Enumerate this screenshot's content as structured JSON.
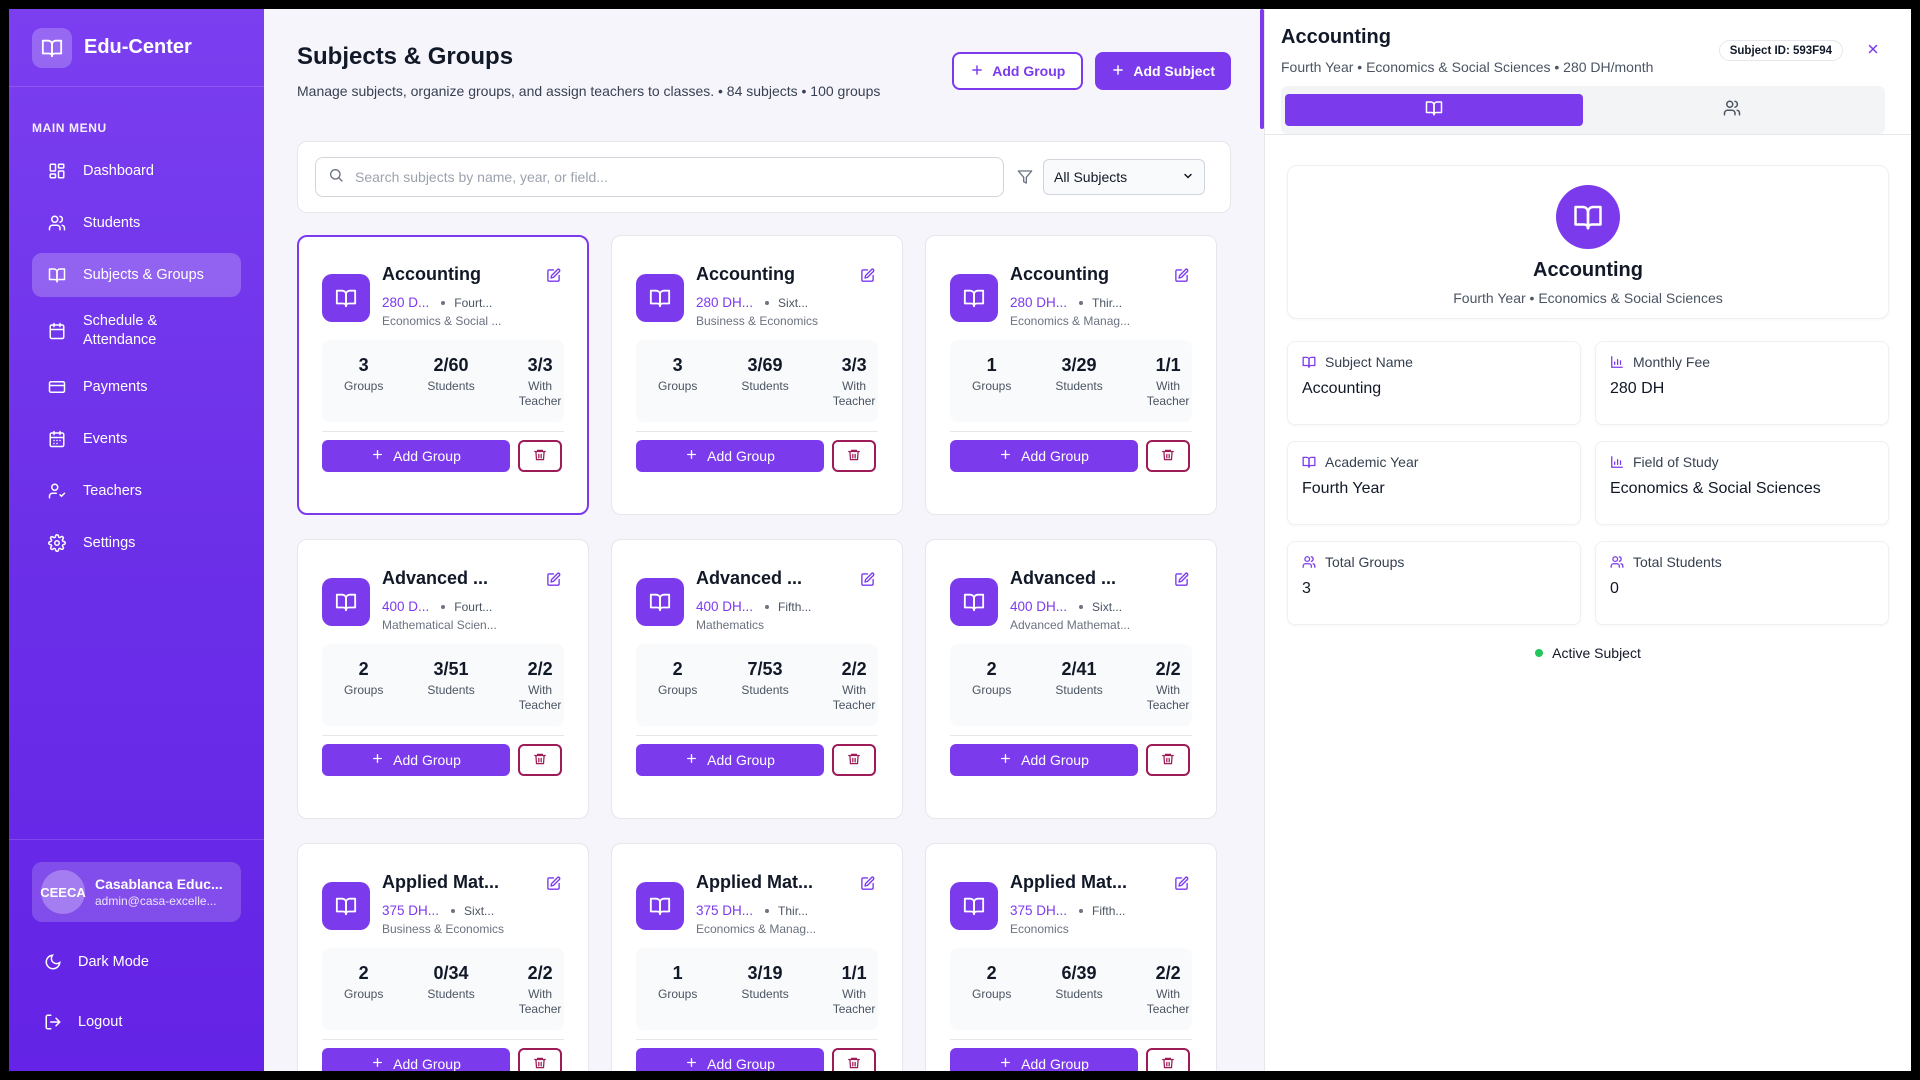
{
  "brand": {
    "name": "Edu-Center"
  },
  "sidebar": {
    "menu_title": "MAIN MENU",
    "items": [
      {
        "label": "Dashboard",
        "icon": "dashboard-icon"
      },
      {
        "label": "Students",
        "icon": "users-icon"
      },
      {
        "label": "Subjects & Groups",
        "icon": "book-icon",
        "active": true
      },
      {
        "label": "Schedule & Attendance",
        "icon": "calendar-icon"
      },
      {
        "label": "Payments",
        "icon": "credit-card-icon"
      },
      {
        "label": "Events",
        "icon": "calendar-days-icon"
      },
      {
        "label": "Teachers",
        "icon": "teacher-icon"
      },
      {
        "label": "Settings",
        "icon": "gear-icon"
      }
    ],
    "user": {
      "initials": "CEECA",
      "name": "Casablanca Educ...",
      "email": "admin@casa-excelle..."
    },
    "dark_mode_label": "Dark Mode",
    "logout_label": "Logout"
  },
  "page": {
    "title": "Subjects & Groups",
    "subtitle": "Manage subjects, organize groups, and assign teachers to classes. • 84 subjects • 100 groups",
    "add_group_label": "Add Group",
    "add_subject_label": "Add Subject",
    "search_placeholder": "Search subjects by name, year, or field...",
    "filter_value": "All Subjects"
  },
  "labels": {
    "groups": "Groups",
    "students": "Students",
    "with_teacher": "With Teacher",
    "add_group": "Add Group"
  },
  "cards": [
    {
      "title": "Accounting",
      "fee": "280 D...",
      "year": "Fourt...",
      "field": "Economics & Social ...",
      "groups": "3",
      "students": "2/60",
      "with_teacher": "3/3",
      "selected": true
    },
    {
      "title": "Accounting",
      "fee": "280 DH...",
      "year": "Sixt...",
      "field": "Business & Economics",
      "groups": "3",
      "students": "3/69",
      "with_teacher": "3/3"
    },
    {
      "title": "Accounting",
      "fee": "280 DH...",
      "year": "Thir...",
      "field": "Economics & Manag...",
      "groups": "1",
      "students": "3/29",
      "with_teacher": "1/1"
    },
    {
      "title": "Advanced ...",
      "fee": "400 D...",
      "year": "Fourt...",
      "field": "Mathematical Scien...",
      "groups": "2",
      "students": "3/51",
      "with_teacher": "2/2"
    },
    {
      "title": "Advanced ...",
      "fee": "400 DH...",
      "year": "Fifth...",
      "field": "Mathematics",
      "groups": "2",
      "students": "7/53",
      "with_teacher": "2/2"
    },
    {
      "title": "Advanced ...",
      "fee": "400 DH...",
      "year": "Sixt...",
      "field": "Advanced Mathemat...",
      "groups": "2",
      "students": "2/41",
      "with_teacher": "2/2"
    },
    {
      "title": "Applied Mat...",
      "fee": "375 DH...",
      "year": "Sixt...",
      "field": "Business & Economics",
      "groups": "2",
      "students": "0/34",
      "with_teacher": "2/2"
    },
    {
      "title": "Applied Mat...",
      "fee": "375 DH...",
      "year": "Thir...",
      "field": "Economics & Manag...",
      "groups": "1",
      "students": "3/19",
      "with_teacher": "1/1"
    },
    {
      "title": "Applied Mat...",
      "fee": "375 DH...",
      "year": "Fifth...",
      "field": "Economics",
      "groups": "2",
      "students": "6/39",
      "with_teacher": "2/2"
    }
  ],
  "details": {
    "title": "Accounting",
    "subtitle": "Fourth Year • Economics & Social Sciences • 280 DH/month",
    "subject_id": "Subject ID: 593F94",
    "hero_title": "Accounting",
    "hero_sub": "Fourth Year • Economics & Social Sciences",
    "fields": [
      {
        "label": "Subject Name",
        "value": "Accounting",
        "icon": "book-icon"
      },
      {
        "label": "Monthly Fee",
        "value": "280 DH",
        "icon": "bar-chart-icon"
      },
      {
        "label": "Academic Year",
        "value": "Fourth Year",
        "icon": "book-icon"
      },
      {
        "label": "Field of Study",
        "value": "Economics & Social Sciences",
        "icon": "bar-chart-icon"
      },
      {
        "label": "Total Groups",
        "value": "3",
        "icon": "users-icon"
      },
      {
        "label": "Total Students",
        "value": "0",
        "icon": "users-icon"
      }
    ],
    "status": "Active Subject"
  },
  "colors": {
    "accent": "#7c3aed",
    "danger": "#9d1b57",
    "success": "#22c55e"
  }
}
